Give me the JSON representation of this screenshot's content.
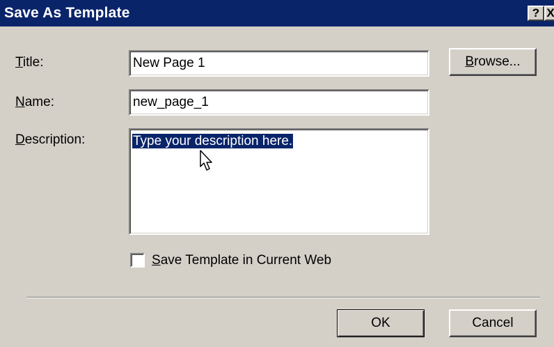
{
  "dialog": {
    "title": "Save As Template",
    "help_button": "?",
    "close_button": "X"
  },
  "form": {
    "title_label_key": "T",
    "title_label_rest": "itle:",
    "title_value": "New Page 1",
    "name_label_key": "N",
    "name_label_rest": "ame:",
    "name_value": "new_page_1",
    "description_label_key": "D",
    "description_label_rest": "escription:",
    "description_value": "Type your description here.",
    "save_in_web_key": "S",
    "save_in_web_rest": "ave Template in Current Web",
    "save_in_web_checked": false
  },
  "buttons": {
    "browse_key": "B",
    "browse_rest": "rowse...",
    "ok": "OK",
    "cancel": "Cancel"
  },
  "colors": {
    "titlebar": "#0a246a",
    "dialog_bg": "#d4d0c8",
    "selection": "#0a246a"
  }
}
